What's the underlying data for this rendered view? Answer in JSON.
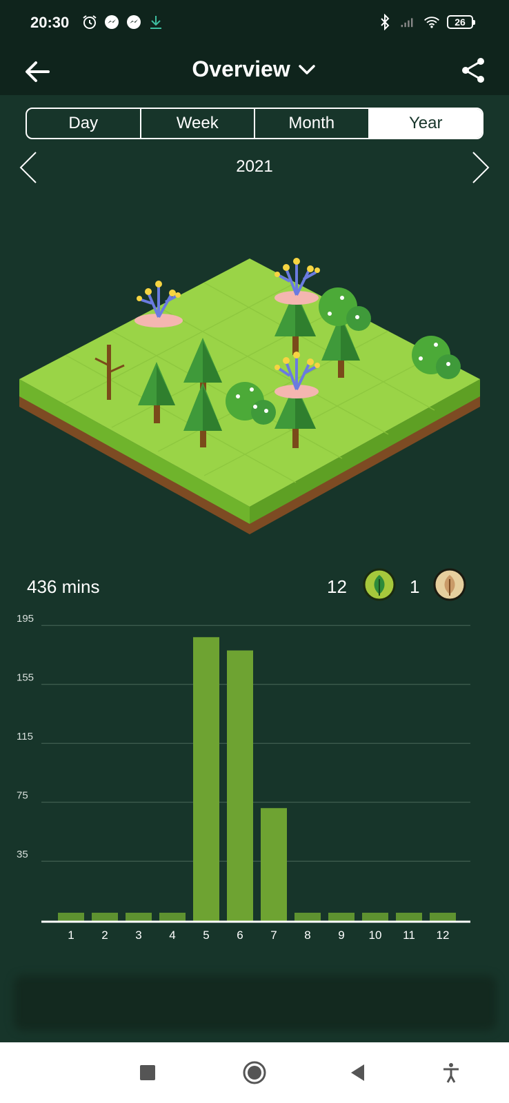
{
  "status_bar": {
    "time": "20:30",
    "left_icons": [
      "alarm-icon",
      "messenger-icon",
      "messenger-icon",
      "download-icon"
    ],
    "right_icons": [
      "bluetooth-icon",
      "signal-icon",
      "wifi-icon"
    ],
    "battery": "26"
  },
  "app_bar": {
    "title": "Overview",
    "back_icon": "arrow-left-icon",
    "dropdown_icon": "chevron-down-icon",
    "share_icon": "share-icon"
  },
  "period_tabs": {
    "tabs": [
      {
        "label": "Day",
        "active": false
      },
      {
        "label": "Week",
        "active": false
      },
      {
        "label": "Month",
        "active": false
      },
      {
        "label": "Year",
        "active": true
      }
    ]
  },
  "year_nav": {
    "year": "2021",
    "prev_icon": "chevron-left-icon",
    "next_icon": "chevron-right-icon"
  },
  "forest": {
    "description": "isometric forest tile with trees, bushes and coral flowers",
    "items": [
      "pine-tree",
      "pine-tree",
      "pine-tree",
      "pine-tree",
      "pine-tree",
      "pine-tree",
      "coral-flower",
      "coral-flower",
      "coral-flower",
      "bush",
      "bush",
      "bush",
      "dead-tree"
    ]
  },
  "summary": {
    "total_time": "436 mins",
    "live_trees": "12",
    "dead_trees": "1"
  },
  "colors": {
    "background": "#17352a",
    "header": "#0f241c",
    "bar": "#6ea332",
    "bar_dark": "#5e9230",
    "gridline": "#4a6a5a",
    "live_badge": "#a6c83c",
    "dead_badge": "#e6cf9e"
  },
  "chart_data": {
    "type": "bar",
    "title": "",
    "xlabel": "",
    "ylabel": "",
    "categories": [
      "1",
      "2",
      "3",
      "4",
      "5",
      "6",
      "7",
      "8",
      "9",
      "10",
      "11",
      "12"
    ],
    "values": [
      0,
      0,
      0,
      0,
      187,
      178,
      71,
      0,
      0,
      0,
      0,
      0
    ],
    "yticks": [
      35,
      75,
      115,
      155,
      195
    ],
    "ylim": [
      0,
      195
    ],
    "grid": true,
    "legend": "none"
  },
  "nav_bar": {
    "buttons": [
      "recents-square-icon",
      "home-circle-icon",
      "back-triangle-icon",
      "accessibility-icon"
    ]
  }
}
